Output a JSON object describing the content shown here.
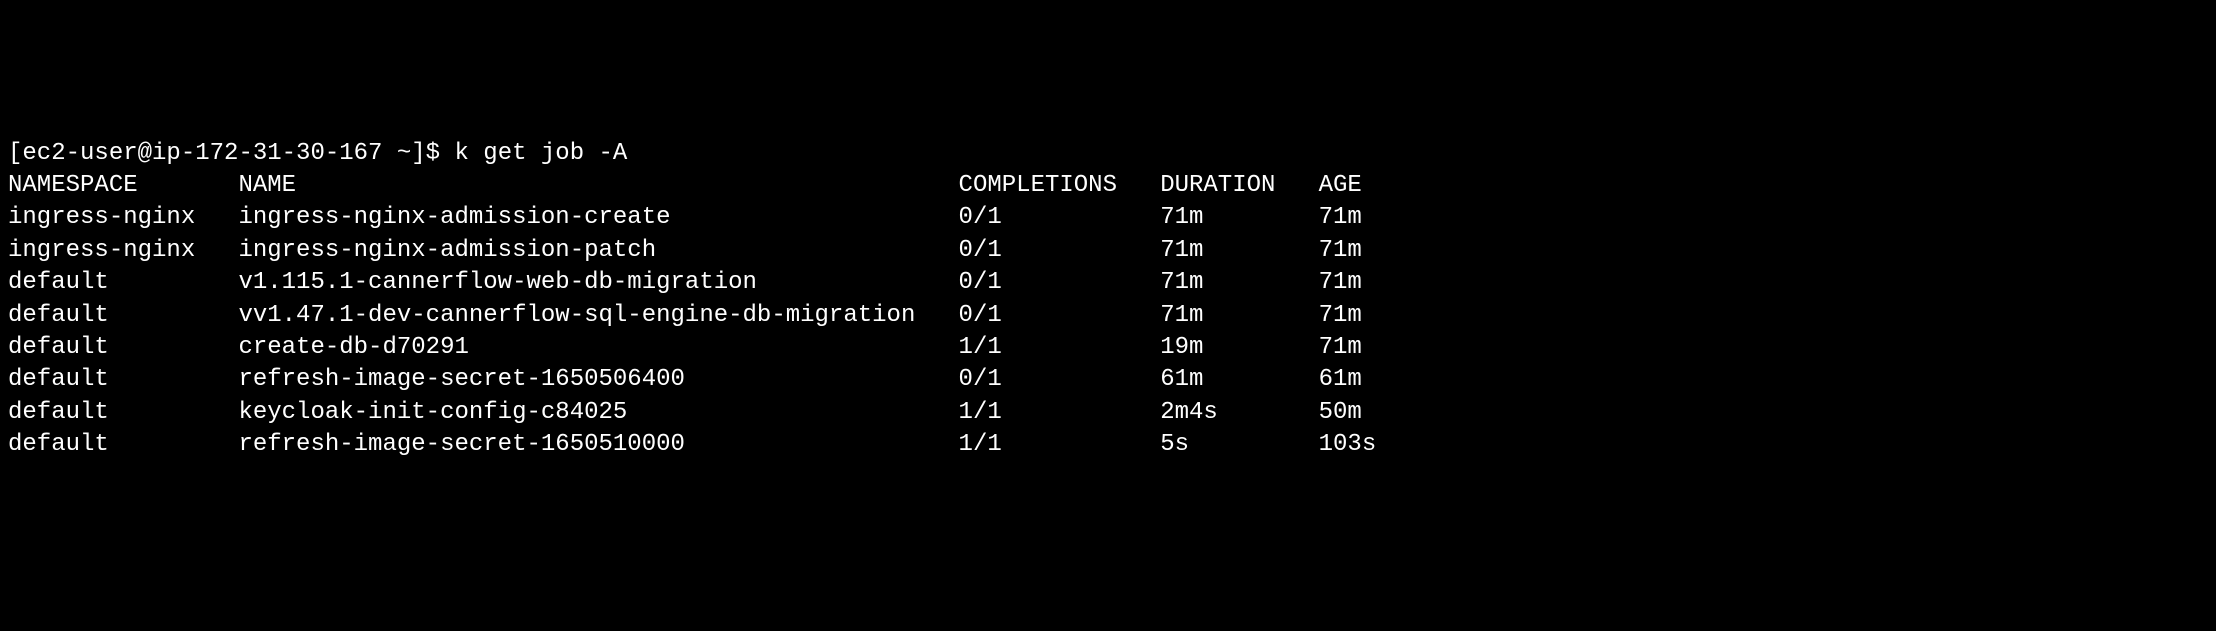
{
  "prompt": {
    "user_host": "[ec2-user@ip-172-31-30-167 ~]$ ",
    "command": "k get job -A"
  },
  "table": {
    "headers": {
      "namespace": "NAMESPACE",
      "name": "NAME",
      "completions": "COMPLETIONS",
      "duration": "DURATION",
      "age": "AGE"
    },
    "rows": [
      {
        "namespace": "ingress-nginx",
        "name": "ingress-nginx-admission-create",
        "completions": "0/1",
        "duration": "71m",
        "age": "71m"
      },
      {
        "namespace": "ingress-nginx",
        "name": "ingress-nginx-admission-patch",
        "completions": "0/1",
        "duration": "71m",
        "age": "71m"
      },
      {
        "namespace": "default",
        "name": "v1.115.1-cannerflow-web-db-migration",
        "completions": "0/1",
        "duration": "71m",
        "age": "71m"
      },
      {
        "namespace": "default",
        "name": "vv1.47.1-dev-cannerflow-sql-engine-db-migration",
        "completions": "0/1",
        "duration": "71m",
        "age": "71m"
      },
      {
        "namespace": "default",
        "name": "create-db-d70291",
        "completions": "1/1",
        "duration": "19m",
        "age": "71m"
      },
      {
        "namespace": "default",
        "name": "refresh-image-secret-1650506400",
        "completions": "0/1",
        "duration": "61m",
        "age": "61m"
      },
      {
        "namespace": "default",
        "name": "keycloak-init-config-c84025",
        "completions": "1/1",
        "duration": "2m4s",
        "age": "50m"
      },
      {
        "namespace": "default",
        "name": "refresh-image-secret-1650510000",
        "completions": "1/1",
        "duration": "5s",
        "age": "103s"
      }
    ]
  },
  "col_widths": {
    "namespace": 16,
    "name": 50,
    "completions": 14,
    "duration": 11,
    "age": 6
  }
}
